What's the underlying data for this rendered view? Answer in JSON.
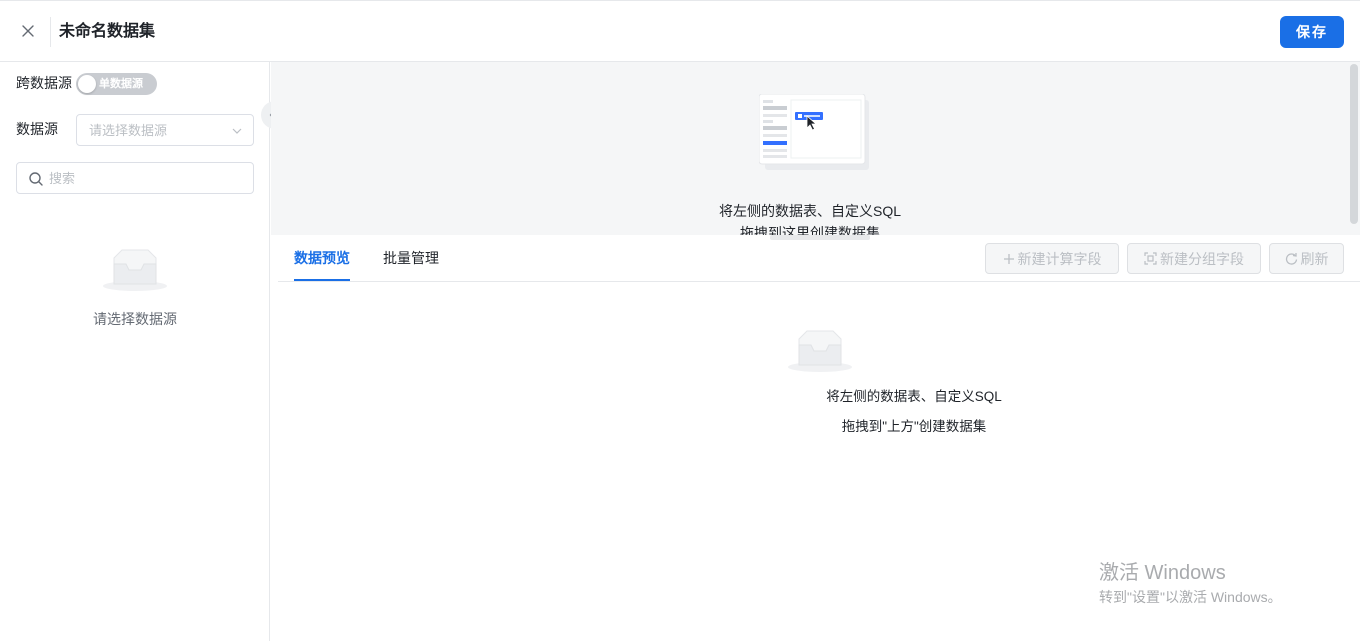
{
  "header": {
    "title": "未命名数据集",
    "save_label": "保存"
  },
  "left": {
    "cross_source_label": "跨数据源",
    "toggle_text": "单数据源",
    "source_label": "数据源",
    "source_placeholder": "请选择数据源",
    "search_placeholder": "搜索",
    "empty_text": "请选择数据源"
  },
  "drop": {
    "line1": "将左侧的数据表、自定义SQL",
    "line2": "拖拽到这里创建数据集"
  },
  "preview": {
    "tabs": [
      {
        "label": "数据预览",
        "active": true
      },
      {
        "label": "批量管理",
        "active": false
      }
    ],
    "buttons": {
      "new_calc": "新建计算字段",
      "new_group": "新建分组字段",
      "refresh": "刷新"
    },
    "empty_line1": "将左侧的数据表、自定义SQL",
    "empty_line2": "拖拽到\"上方\"创建数据集"
  },
  "watermark": {
    "title": "激活 Windows",
    "subtitle": "转到\"设置\"以激活 Windows。"
  },
  "colors": {
    "primary": "#1a6fe6",
    "border": "#e6e8eb",
    "drop_bg": "#f5f6f7",
    "muted_text": "#bbbfc4"
  },
  "icons": [
    "close-icon",
    "chevron-down-icon",
    "search-icon",
    "empty-box-icon",
    "chevron-left-icon",
    "plus-icon",
    "group-icon",
    "refresh-icon",
    "cursor-icon"
  ]
}
